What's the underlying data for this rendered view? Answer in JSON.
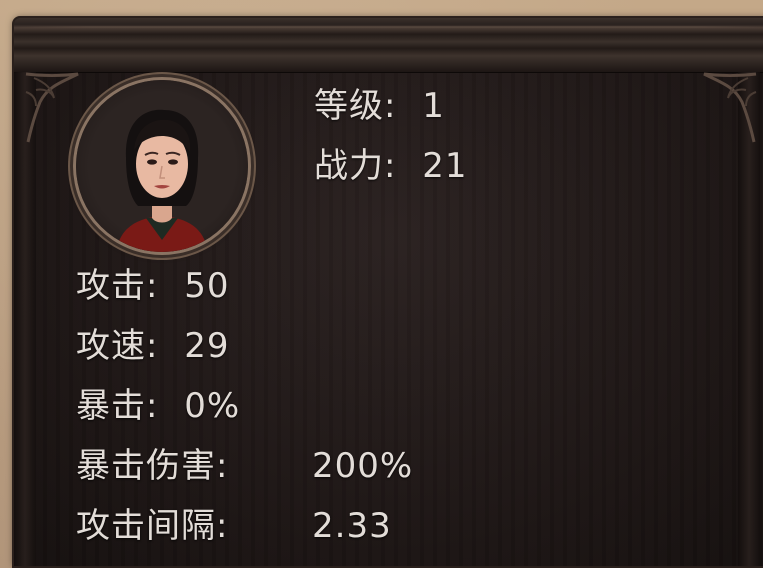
{
  "character": {
    "portrait": "female-character-portrait",
    "level_label": "等级:",
    "level_value": "1",
    "power_label": "战力:",
    "power_value": "21"
  },
  "stats": [
    {
      "label": "攻击:",
      "value": "50"
    },
    {
      "label": "攻速:",
      "value": "29"
    },
    {
      "label": "暴击:",
      "value": "0%"
    },
    {
      "label": "暴击伤害:",
      "value": "200%"
    },
    {
      "label": "攻击间隔:",
      "value": "2.33"
    }
  ],
  "colors": {
    "panel_bg": "#1c1514",
    "text": "#e3ddd8",
    "frame_gold": "#8a7463",
    "parchment": "#b89d7e"
  }
}
